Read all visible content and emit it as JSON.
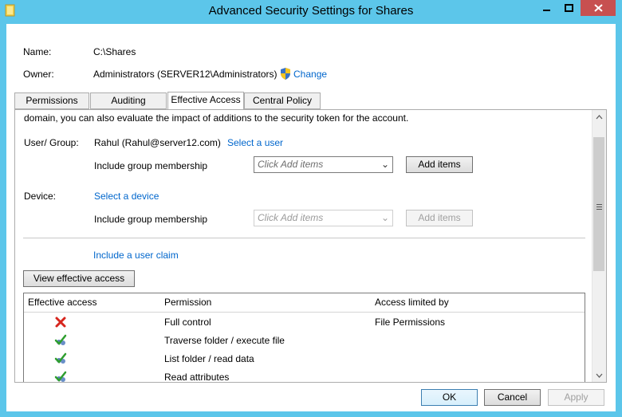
{
  "window": {
    "title": "Advanced Security Settings for Shares",
    "app_icon": "folder-icon",
    "controls": {
      "minimize": "minimize-icon",
      "maximize": "maximize-icon",
      "close": "close-icon"
    }
  },
  "header": {
    "name_label": "Name:",
    "name_value": "C:\\Shares",
    "owner_label": "Owner:",
    "owner_value": "Administrators (SERVER12\\Administrators)",
    "change_link": "Change",
    "change_icon": "uac-shield-icon"
  },
  "tabs": [
    {
      "label": "Permissions",
      "active": false
    },
    {
      "label": "Auditing",
      "active": false
    },
    {
      "label": "Effective Access",
      "active": true
    },
    {
      "label": "Central Policy",
      "active": false
    }
  ],
  "effective_access": {
    "intro_text": "domain, you can also evaluate the impact of additions to the security token for the account.",
    "user_group_label": "User/ Group:",
    "user_group_value": "Rahul (Rahul@server12.com)",
    "select_user_link": "Select a user",
    "user_include_label": "Include group membership",
    "user_combo_placeholder": "Click Add items",
    "user_add_items": "Add items",
    "device_label": "Device:",
    "select_device_link": "Select a device",
    "device_include_label": "Include group membership",
    "device_combo_placeholder": "Click Add items",
    "device_add_items": "Add items",
    "include_claim_link": "Include a user claim",
    "view_button": "View effective access",
    "table": {
      "headers": [
        "Effective access",
        "Permission",
        "Access limited by"
      ],
      "rows": [
        {
          "icon": "denied-x-icon",
          "permission": "Full control",
          "limited_by": "File Permissions"
        },
        {
          "icon": "allowed-check-icon",
          "permission": "Traverse folder / execute file",
          "limited_by": ""
        },
        {
          "icon": "allowed-check-icon",
          "permission": "List folder / read data",
          "limited_by": ""
        },
        {
          "icon": "allowed-check-icon",
          "permission": "Read attributes",
          "limited_by": ""
        }
      ]
    }
  },
  "footer": {
    "ok": "OK",
    "cancel": "Cancel",
    "apply": "Apply"
  },
  "colors": {
    "frame": "#5cc6ea",
    "link": "#0066cc",
    "close_button": "#c75050"
  }
}
